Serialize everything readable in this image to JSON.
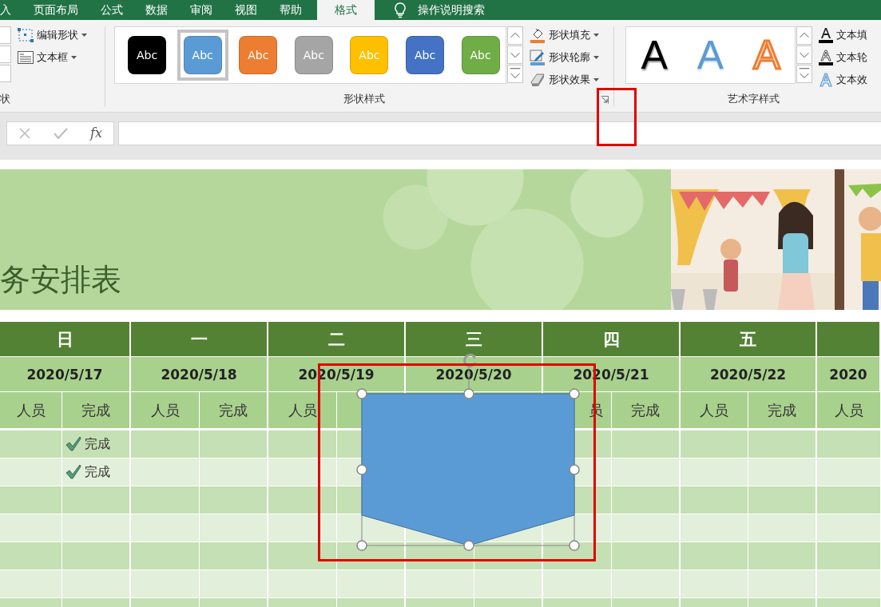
{
  "ribbon_tabs": [
    {
      "label": "入",
      "selected": false
    },
    {
      "label": "页面布局",
      "selected": false
    },
    {
      "label": "公式",
      "selected": false
    },
    {
      "label": "数据",
      "selected": false
    },
    {
      "label": "审阅",
      "selected": false
    },
    {
      "label": "视图",
      "selected": false
    },
    {
      "label": "帮助",
      "selected": false
    },
    {
      "label": "格式",
      "selected": true
    }
  ],
  "tell_me": "操作说明搜索",
  "insert_shapes_group": {
    "label": "状",
    "buttons": [
      {
        "label": "编辑形状",
        "kind": "edit-shape"
      },
      {
        "label": "文本框",
        "kind": "textbox"
      }
    ]
  },
  "shape_styles": {
    "label": "形状样式",
    "swatches": [
      {
        "text": "Abc",
        "color": "#000000",
        "selected": false
      },
      {
        "text": "Abc",
        "color": "#5b9bd5",
        "selected": true
      },
      {
        "text": "Abc",
        "color": "#ed7d31",
        "selected": false
      },
      {
        "text": "Abc",
        "color": "#a5a5a5",
        "selected": false
      },
      {
        "text": "Abc",
        "color": "#ffc000",
        "selected": false
      },
      {
        "text": "Abc",
        "color": "#4472c4",
        "selected": false
      },
      {
        "text": "Abc",
        "color": "#70ad47",
        "selected": false
      }
    ],
    "buttons": [
      {
        "label": "形状填充",
        "kind": "fill"
      },
      {
        "label": "形状轮廓",
        "kind": "outline"
      },
      {
        "label": "形状效果",
        "kind": "effect"
      }
    ]
  },
  "wordart_styles": {
    "label": "艺术字样式",
    "samples": [
      {
        "text": "A",
        "kind": "plain"
      },
      {
        "text": "A",
        "kind": "blue"
      },
      {
        "text": "A",
        "kind": "orange-outline"
      }
    ],
    "buttons": [
      {
        "label": "文本填",
        "kind": "fill"
      },
      {
        "label": "文本轮",
        "kind": "outline"
      },
      {
        "label": "文本效",
        "kind": "effect"
      }
    ]
  },
  "formula_bar": {
    "function_label": "fx"
  },
  "banner": {
    "title": "务安排表"
  },
  "table": {
    "days": [
      {
        "day": "日",
        "date": "2020/5/17",
        "staff_label": "人员",
        "done_label": "完成"
      },
      {
        "day": "一",
        "date": "2020/5/18",
        "staff_label": "人员",
        "done_label": "完成"
      },
      {
        "day": "二",
        "date": "2020/5/19",
        "staff_label": "人员"
      },
      {
        "day": "三",
        "date": "2020/5/20"
      },
      {
        "day": "四",
        "date": "2020/5/21",
        "staff_label": "员",
        "done_label": "完成"
      },
      {
        "day": "五",
        "date": "2020/5/22",
        "staff_label": "人员",
        "done_label": "完成"
      },
      {
        "date": "2020",
        "staff_label": "人员"
      }
    ],
    "rows": [
      {
        "kind": "done",
        "label": "完成"
      },
      {
        "kind": "done",
        "label": "完成"
      },
      {
        "kind": "empty"
      },
      {
        "kind": "empty"
      },
      {
        "kind": "empty"
      },
      {
        "kind": "empty"
      },
      {
        "kind": "empty"
      }
    ]
  }
}
